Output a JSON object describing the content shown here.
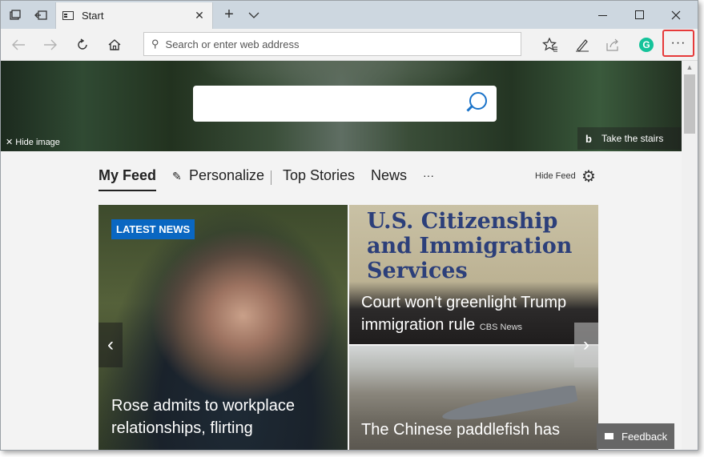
{
  "titlebar": {
    "tab_title": "Start",
    "icons": [
      "tab-preview-icon",
      "set-aside-tabs-icon",
      "new-tab-icon",
      "tab-list-chevron-icon",
      "minimize-icon",
      "maximize-icon",
      "close-icon"
    ]
  },
  "navbar": {
    "address_placeholder": "Search or enter web address",
    "grammarly_letter": "G",
    "more_label": "···"
  },
  "hero": {
    "hide_image_label": "Hide image",
    "bing_letter": "b",
    "take_stairs_label": "Take the stairs"
  },
  "feed_nav": {
    "my_feed": "My Feed",
    "personalize": "Personalize",
    "top_stories": "Top Stories",
    "news": "News",
    "more": "···",
    "hide_feed": "Hide Feed"
  },
  "cards": {
    "main": {
      "badge": "LATEST NEWS",
      "headline": "Rose admits to workplace relationships, flirting"
    },
    "top": {
      "sign_text": "U.S. Citizenship and Immigration Services",
      "headline": "Court won't greenlight Trump immigration rule",
      "source": "CBS News"
    },
    "bottom": {
      "headline": "The Chinese paddlefish has"
    }
  },
  "feedback_label": "Feedback",
  "colors": {
    "accent": "#0a67c2",
    "highlight_border": "#e63a3a",
    "grammarly": "#15c39a"
  }
}
